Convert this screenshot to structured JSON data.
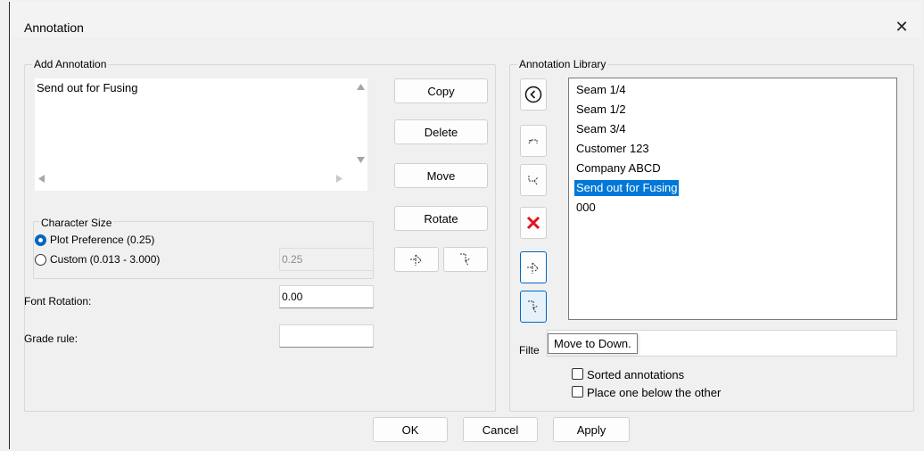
{
  "window": {
    "title": "Annotation",
    "close_label": "✕"
  },
  "add_annotation": {
    "label": "Add Annotation",
    "text": "Send out for Fusing"
  },
  "character_size": {
    "label": "Character Size",
    "plot_preference_label": "Plot Preference (0.25)",
    "custom_label": "Custom (0.013 - 3.000)",
    "custom_value": "0.25",
    "selected": "plot_preference"
  },
  "font_rotation": {
    "label": "Font Rotation:",
    "value": "0.00"
  },
  "grade_rule": {
    "label": "Grade rule:",
    "value": ""
  },
  "actions": {
    "copy": "Copy",
    "delete": "Delete",
    "move": "Move",
    "rotate": "Rotate"
  },
  "library": {
    "label": "Annotation Library",
    "items": [
      "Seam 1/4",
      "Seam 1/2",
      "Seam 3/4",
      "Customer 123",
      "Company ABCD",
      "Send out for Fusing",
      "000"
    ],
    "selected_index": 5
  },
  "filter": {
    "label": "Filter",
    "visible_label": "Filte",
    "value": ""
  },
  "tooltip": "Move to Down.",
  "options": {
    "sorted_label": "Sorted annotations",
    "sorted_checked": false,
    "place_below_label": "Place one below the other",
    "place_below_checked": false
  },
  "footer": {
    "ok": "OK",
    "cancel": "Cancel",
    "apply": "Apply"
  },
  "colors": {
    "accent": "#0067c0",
    "selection": "#0078d7",
    "delete_red": "#e81123"
  }
}
